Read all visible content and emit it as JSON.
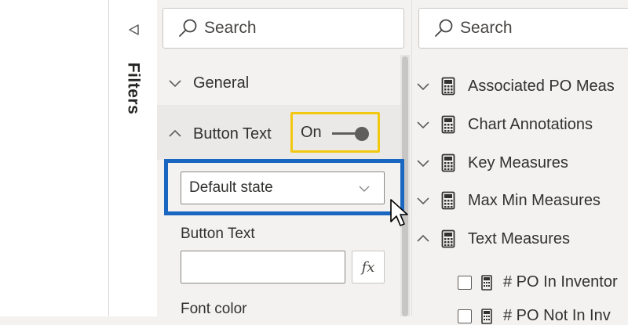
{
  "filters_pane": {
    "label": "Filters"
  },
  "format_pane": {
    "search_placeholder": "Search",
    "sections": {
      "general": "General",
      "button_text": "Button Text"
    },
    "toggle": {
      "label": "On",
      "state": true
    },
    "state_dropdown": {
      "selected": "Default state"
    },
    "button_text_field": {
      "label": "Button Text",
      "value": "",
      "fx_label": "fx"
    },
    "font_color_label": "Font color"
  },
  "fields_pane": {
    "search_placeholder": "Search",
    "tables": [
      {
        "name": "Associated PO Meas",
        "expanded": false
      },
      {
        "name": "Chart Annotations",
        "expanded": false
      },
      {
        "name": "Key Measures",
        "expanded": false
      },
      {
        "name": "Max Min Measures",
        "expanded": false
      },
      {
        "name": "Text Measures",
        "expanded": true
      }
    ],
    "measures": [
      "# PO In Inventor",
      "# PO Not In Inv"
    ]
  },
  "colors": {
    "highlight": "#1a67c1",
    "toggle_outline": "#f2c811"
  }
}
